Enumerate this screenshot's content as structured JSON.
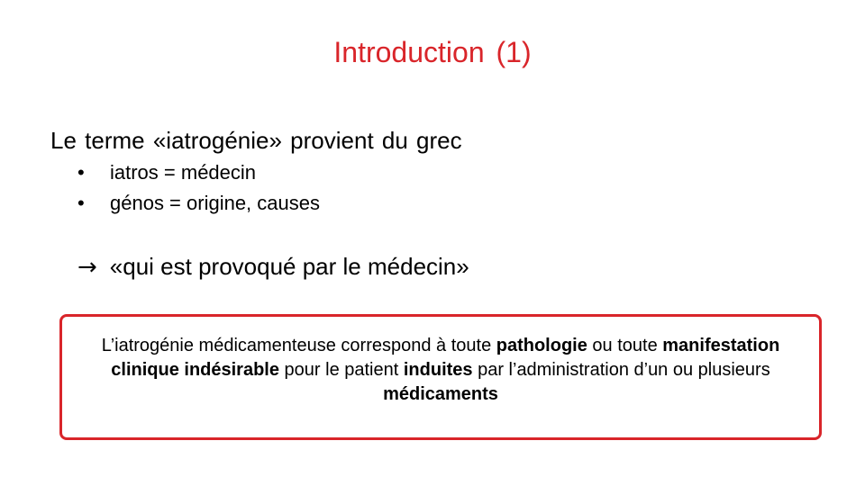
{
  "slide": {
    "title": "Introduction (1)",
    "lead": "Le terme «iatrogénie» provient du grec",
    "bullets": [
      {
        "marker": "•",
        "text": "iatros = médecin"
      },
      {
        "marker": "•",
        "text": "génos = origine, causes"
      }
    ],
    "arrow": "→",
    "arrow_text": "«qui est provoqué par le médecin»",
    "definition": {
      "part1": "L’iatrogénie médicamenteuse correspond à toute ",
      "bold1": "pathologie",
      "part2": " ou toute ",
      "bold2": "manifestation clinique indésirable",
      "part3": " pour le patient ",
      "bold3": "induites",
      "part4": " par l’administration d’un ou plusieurs ",
      "bold4": "médicaments"
    },
    "colors": {
      "accent": "#d9252a",
      "text": "#000000",
      "background": "#ffffff"
    }
  }
}
